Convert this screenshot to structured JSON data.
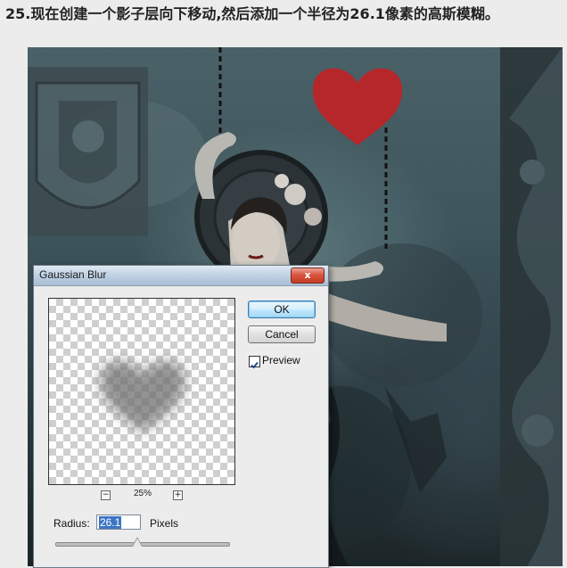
{
  "instruction": "25.现在创建一个影子层向下移动,然后添加一个半径为26.1像素的高斯模糊。",
  "dialog": {
    "title": "Gaussian Blur",
    "close_label": "x",
    "ok_label": "OK",
    "cancel_label": "Cancel",
    "preview_label": "Preview",
    "preview_checked": true,
    "zoom_out_symbol": "−",
    "zoom_in_symbol": "+",
    "zoom_level": "25%",
    "radius_label": "Radius:",
    "radius_value": "26.1",
    "radius_unit": "Pixels",
    "slider_position_fraction": 0.47
  },
  "colors": {
    "heart": "#b5272a",
    "ok_border": "#3c7fb1",
    "selection": "#3b75c4"
  },
  "icons": {
    "close": "close-icon",
    "check": "checkmark-icon",
    "zoom_in": "zoom-in-icon",
    "zoom_out": "zoom-out-icon"
  }
}
